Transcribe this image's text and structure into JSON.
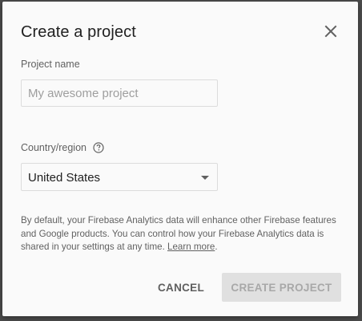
{
  "dialog": {
    "title": "Create a project",
    "close_icon": "close-icon"
  },
  "project_name": {
    "label": "Project name",
    "placeholder": "My awesome project",
    "value": ""
  },
  "country": {
    "label": "Country/region",
    "help_icon": "help-circle-icon",
    "selected": "United States"
  },
  "disclaimer": {
    "text": "By default, your Firebase Analytics data will enhance other Firebase features and Google products. You can control how your Firebase Analytics data is shared in your settings at any time. ",
    "link_text": "Learn more",
    "suffix": "."
  },
  "actions": {
    "cancel_label": "CANCEL",
    "create_label": "CREATE PROJECT",
    "create_enabled": false
  },
  "colors": {
    "dialog_bg": "#fafafa",
    "backdrop": "#4a4a4a",
    "disabled_button_bg": "#e0e0e0",
    "disabled_button_text": "#a8a8a8"
  }
}
